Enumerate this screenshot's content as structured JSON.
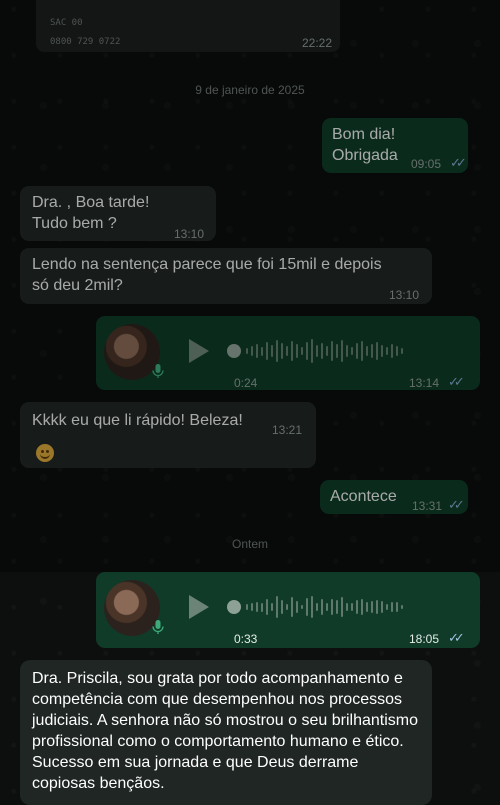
{
  "receipt": {
    "line1": "SAC 00",
    "line2": "0800 729 0722",
    "time": "22:22"
  },
  "date_dividers": [
    "9 de janeiro de 2025",
    "Ontem"
  ],
  "messages": [
    {
      "text_lines": [
        "Bom dia!",
        "Obrigada"
      ],
      "time": "09:05",
      "dir": "out"
    },
    {
      "text_lines": [
        "Dra. , Boa tarde!",
        "Tudo bem ?"
      ],
      "time": "13:10",
      "dir": "in"
    },
    {
      "text_lines": [
        "Lendo na sentença parece que foi 15mil e depois",
        "só deu 2mil?"
      ],
      "time": "13:10",
      "dir": "in"
    },
    {
      "voice_duration": "0:24",
      "time": "13:14",
      "dir": "out"
    },
    {
      "text": "Kkkk eu que li rápido! Beleza!",
      "time": "13:21",
      "dir": "in",
      "emoji": "grinning-face"
    },
    {
      "text": "Acontece",
      "time": "13:31",
      "dir": "out"
    },
    {
      "voice_duration": "0:33",
      "time": "18:05",
      "dir": "out"
    },
    {
      "text": "Dra. Priscila, sou grata por todo acompanhamento e competência com que desempenhou nos processos judiciais. A senhora não só mostrou o seu brilhantismo profissional como o comportamento humano e ético. Sucesso em sua jornada e que Deus derrame copiosas bençãos.",
      "dir": "in"
    }
  ],
  "ticks": "✓✓",
  "colors": {
    "incoming": "#202624",
    "outgoing": "#0f3b28",
    "read_ticks": "#7ba7c8"
  }
}
